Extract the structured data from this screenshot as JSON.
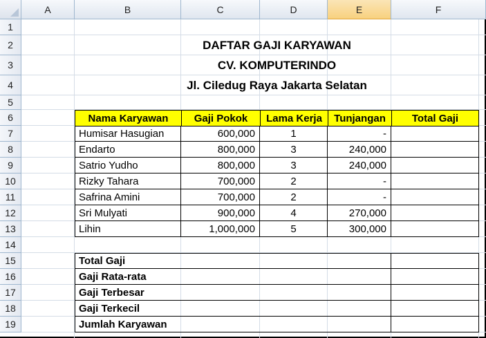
{
  "columns": [
    "A",
    "B",
    "C",
    "D",
    "E",
    "F"
  ],
  "selected_column": "E",
  "rows": [
    "1",
    "2",
    "3",
    "4",
    "5",
    "6",
    "7",
    "8",
    "9",
    "10",
    "11",
    "12",
    "13",
    "14",
    "15",
    "16",
    "17",
    "18",
    "19"
  ],
  "title_lines": [
    "DAFTAR GAJI KARYAWAN",
    "CV. KOMPUTERINDO",
    "Jl. Ciledug Raya Jakarta Selatan"
  ],
  "table_headers": [
    "Nama Karyawan",
    "Gaji Pokok",
    "Lama Kerja",
    "Tunjangan",
    "Total Gaji"
  ],
  "employees": [
    {
      "name": "Humisar Hasugian",
      "gaji_pokok": "600,000",
      "lama_kerja": "1",
      "tunjangan": "-",
      "total": ""
    },
    {
      "name": "Endarto",
      "gaji_pokok": "800,000",
      "lama_kerja": "3",
      "tunjangan": "240,000",
      "total": ""
    },
    {
      "name": "Satrio Yudho",
      "gaji_pokok": "800,000",
      "lama_kerja": "3",
      "tunjangan": "240,000",
      "total": ""
    },
    {
      "name": "Rizky Tahara",
      "gaji_pokok": "700,000",
      "lama_kerja": "2",
      "tunjangan": "-",
      "total": ""
    },
    {
      "name": "Safrina Amini",
      "gaji_pokok": "700,000",
      "lama_kerja": "2",
      "tunjangan": "-",
      "total": ""
    },
    {
      "name": "Sri Mulyati",
      "gaji_pokok": "900,000",
      "lama_kerja": "4",
      "tunjangan": "270,000",
      "total": ""
    },
    {
      "name": "Lihin",
      "gaji_pokok": "1,000,000",
      "lama_kerja": "5",
      "tunjangan": "300,000",
      "total": ""
    }
  ],
  "summary": [
    {
      "label": "Total Gaji",
      "value": ""
    },
    {
      "label": "Gaji Rata-rata",
      "value": ""
    },
    {
      "label": "Gaji Terbesar",
      "value": ""
    },
    {
      "label": "Gaji Terkecil",
      "value": ""
    },
    {
      "label": "Jumlah Karyawan",
      "value": ""
    }
  ],
  "colors": {
    "header_fill": "#ffff00",
    "selected_column_header": "#f8d17f",
    "gridline": "#d4dce6",
    "heading_border": "#9eb6ce"
  }
}
